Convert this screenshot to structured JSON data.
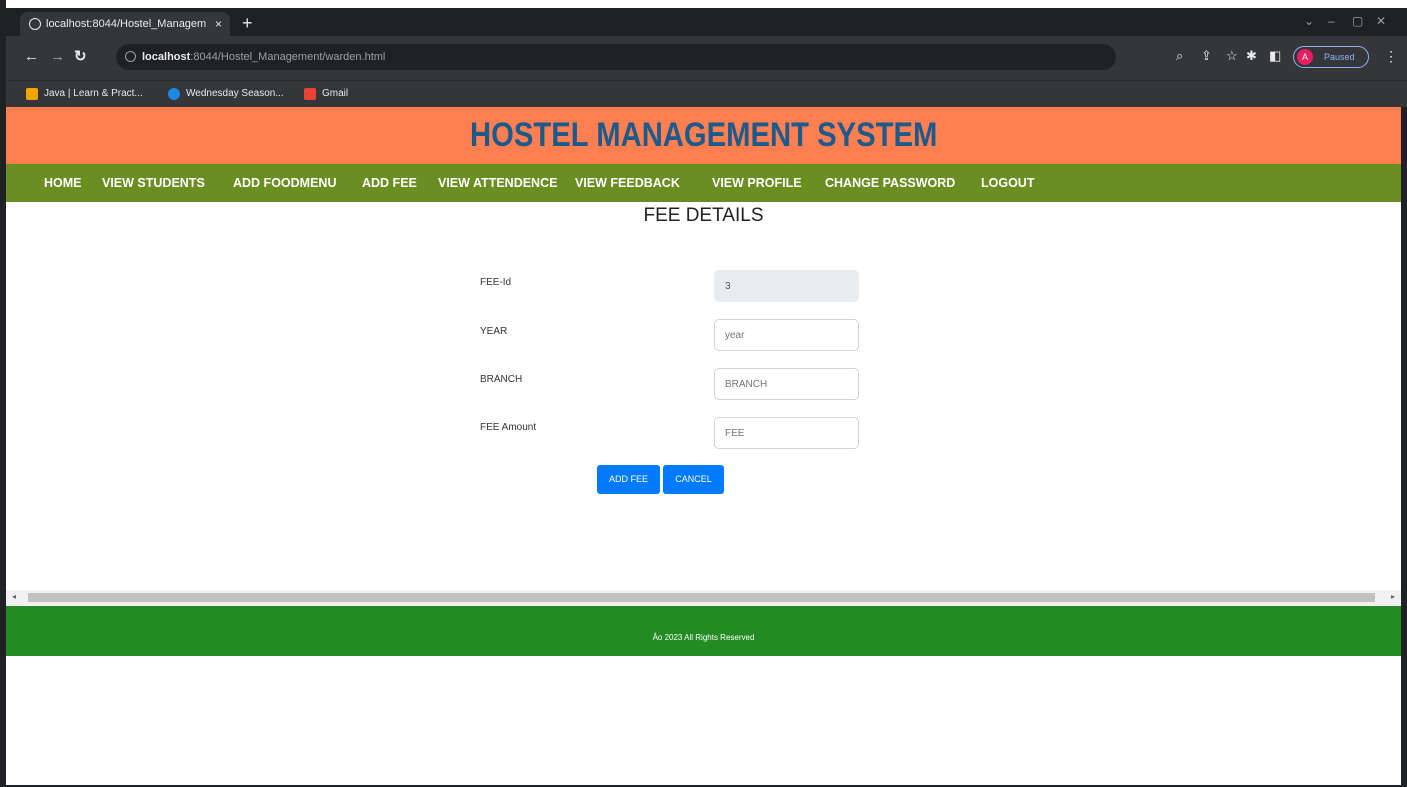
{
  "browser": {
    "tab_title": "localhost:8044/Hostel_Managem",
    "tab_close": "×",
    "new_tab": "+",
    "url_host": "localhost",
    "url_rest": ":8044/Hostel_Management/warden.html",
    "profile_initial": "A",
    "profile_status": "Paused",
    "bookmarks": [
      {
        "label": "Java | Learn & Pract...",
        "color": "#f4a300"
      },
      {
        "label": "Wednesday Season...",
        "color": "#1e88e5"
      },
      {
        "label": "Gmail",
        "color": "#ea4335"
      }
    ]
  },
  "page": {
    "title": "HOSTEL MANAGEMENT SYSTEM",
    "nav": [
      "HOME",
      "VIEW STUDENTS",
      "ADD FOODMENU",
      "ADD FEE",
      "VIEW ATTENDENCE",
      "VIEW FEEDBACK",
      "VIEW PROFILE",
      "CHANGE PASSWORD",
      "LOGOUT"
    ],
    "section_title": "FEE DETAILS",
    "form": {
      "fee_id_label": "FEE-Id",
      "fee_id_value": "3",
      "year_label": "YEAR",
      "year_placeholder": "year",
      "branch_label": "BRANCH",
      "branch_placeholder": "BRANCH",
      "amount_label": "FEE Amount",
      "amount_placeholder": "FEE",
      "add_button": "ADD FEE",
      "cancel_button": "CANCEL"
    },
    "footer_text": "Âo 2023 All Rights Reserved"
  },
  "colors": {
    "header_bg": "#ff7f50",
    "title_color": "#1c5a8c",
    "nav_bg": "#6b8e23",
    "footer_bg": "#228b22",
    "button_bg": "#007bff"
  }
}
